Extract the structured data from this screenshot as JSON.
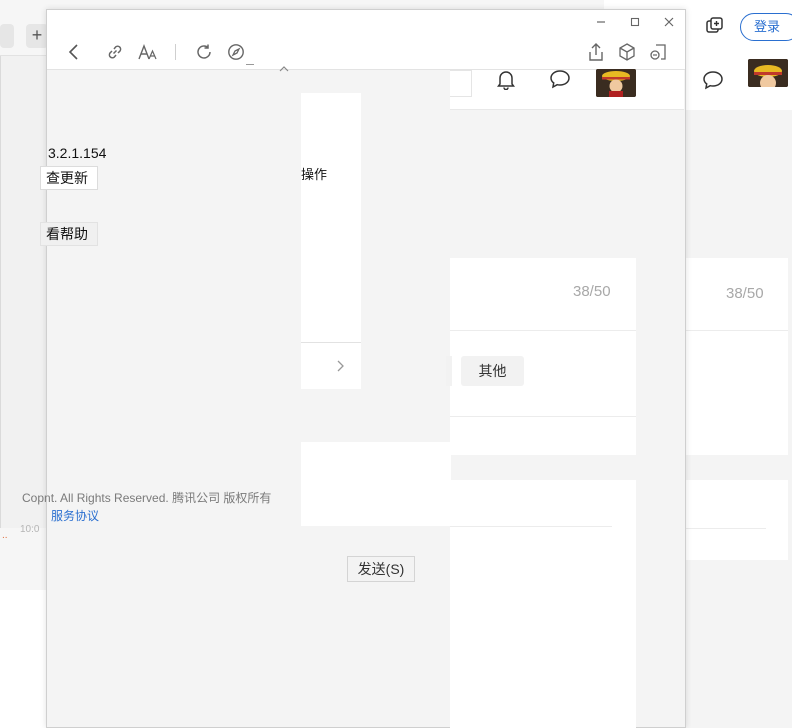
{
  "background_window": {
    "login_label": "登录",
    "count_label": "38/50",
    "plus_label": "+"
  },
  "window": {
    "controls": {
      "minimize": "minimize-icon",
      "maximize": "maximize-icon",
      "close": "close-icon"
    },
    "toolbar_left": [
      "back-icon",
      "link-icon",
      "font-size-icon",
      "refresh-icon",
      "compass-icon"
    ],
    "toolbar_right": [
      "share-icon",
      "cube-icon",
      "window-split-icon"
    ]
  },
  "page": {
    "header_icons": [
      "bell-icon",
      "chat-icon"
    ],
    "count_label": "38/50",
    "chip_label": "其他",
    "send_label": "发送(S)"
  },
  "about_dialog": {
    "version": "3.2.1.154",
    "check_update_label": "查更新",
    "help_label": "看帮助",
    "operation_label": "操作",
    "copyright": "Copyright. All Rights Reserved. 腾讯公司 版权所有",
    "copyright_visible": "Copnt. All Rights Reserved. 腾讯公司 版权所有",
    "agreement_label": "服务协议",
    "bg_time": "10:0",
    "bg_dots": ".."
  },
  "colors": {
    "accent": "#2a6fd0",
    "panel": "#f4f4f4",
    "muted_text": "#a8a8a8"
  }
}
